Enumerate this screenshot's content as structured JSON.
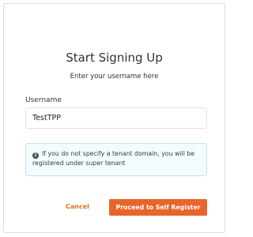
{
  "form": {
    "title": "Start Signing Up",
    "subtitle": "Enter your username here",
    "username_label": "Username",
    "username_value": "TestTPP"
  },
  "info": {
    "icon": "info-icon",
    "text": "If you do not specify a tenant domain, you will be registered under super tenant"
  },
  "actions": {
    "cancel_label": "Cancel",
    "proceed_label": "Proceed to Self Register"
  },
  "colors": {
    "accent": "#e8652a",
    "info_border": "#bfe3ea",
    "info_background": "#f3fbfd"
  }
}
